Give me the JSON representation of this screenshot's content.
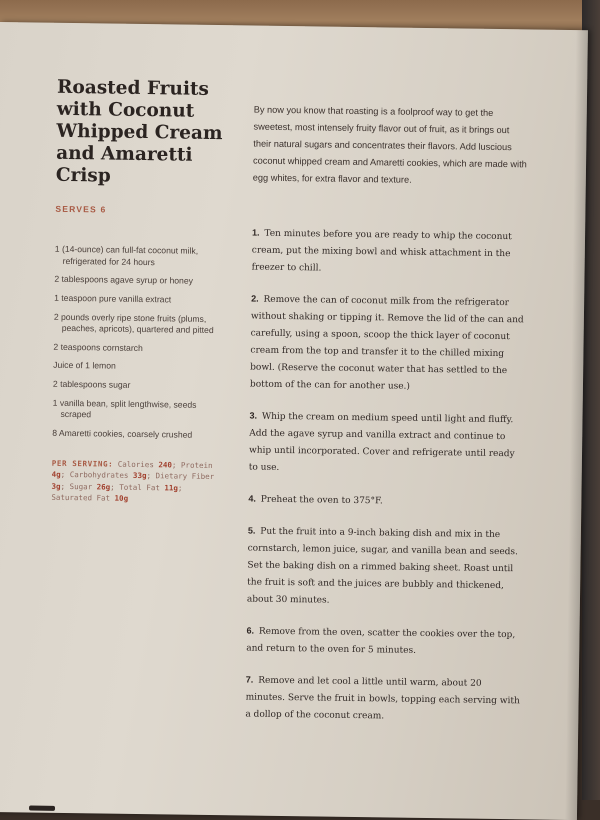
{
  "recipe": {
    "title": "Roasted Fruits with Coconut Whipped Cream and Amaretti Crisp",
    "serves": "SERVES 6",
    "intro": "By now you know that roasting is a foolproof way to get the sweetest, most intensely fruity flavor out of fruit, as it brings out their natural sugars and concentrates their flavors. Add luscious coconut whipped cream and Amaretti cookies, which are made with egg whites, for extra flavor and texture.",
    "ingredients": [
      "1 (14-ounce) can full-fat coconut milk, refrigerated for 24 hours",
      "2 tablespoons agave syrup or honey",
      "1 teaspoon pure vanilla extract",
      "2 pounds overly ripe stone fruits (plums, peaches, apricots), quartered and pitted",
      "2 teaspoons cornstarch",
      "Juice of 1 lemon",
      "2 tablespoons sugar",
      "1 vanilla bean, split lengthwise, seeds scraped",
      "8 Amaretti cookies, coarsely crushed"
    ],
    "nutrition": {
      "label": "PER SERVING:",
      "calories_label": "Calories",
      "calories": "240",
      "protein_label": "Protein",
      "protein": "4g",
      "carbs_label": "Carbohydrates",
      "carbs": "33g",
      "fiber_label": "Dietary Fiber",
      "fiber": "3g",
      "sugar_label": "Sugar",
      "sugar": "26g",
      "fat_label": "Total Fat",
      "fat": "11g",
      "satfat_label": "Saturated Fat",
      "satfat": "10g"
    },
    "steps": [
      {
        "num": "1.",
        "text": "Ten minutes before you are ready to whip the coconut cream, put the mixing bowl and whisk attachment in the freezer to chill."
      },
      {
        "num": "2.",
        "text": "Remove the can of coconut milk from the refrigerator without shaking or tipping it. Remove the lid of the can and carefully, using a spoon, scoop the thick layer of coconut cream from the top and transfer it to the chilled mixing bowl. (Reserve the coconut water that has settled to the bottom of the can for another use.)"
      },
      {
        "num": "3.",
        "text": "Whip the cream on medium speed until light and fluffy. Add the agave syrup and vanilla extract and continue to whip until incorporated. Cover and refrigerate until ready to use."
      },
      {
        "num": "4.",
        "text": "Preheat the oven to 375°F."
      },
      {
        "num": "5.",
        "text": "Put the fruit into a 9-inch baking dish and mix in the cornstarch, lemon juice, sugar, and vanilla bean and seeds. Set the baking dish on a rimmed baking sheet. Roast until the fruit is soft and the juices are bubbly and thickened, about 30 minutes."
      },
      {
        "num": "6.",
        "text": "Remove from the oven, scatter the cookies over the top, and return to the oven for 5 minutes."
      },
      {
        "num": "7.",
        "text": "Remove and let cool a little until warm, about 20 minutes. Serve the fruit in bowls, topping each serving with a dollop of the coconut cream."
      }
    ]
  },
  "colors": {
    "accent": "#a85a44",
    "text": "#2b2421",
    "paper": "#dcd6cc"
  }
}
